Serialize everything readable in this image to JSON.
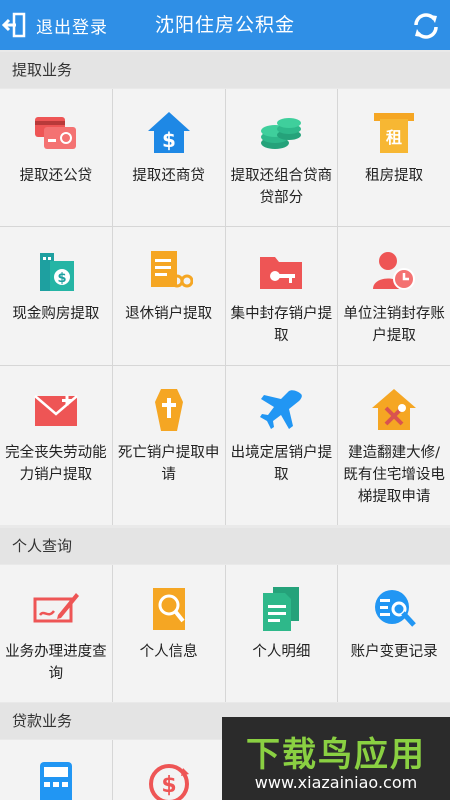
{
  "header": {
    "logout_label": "退出登录",
    "title": "沈阳住房公积金",
    "logout_icon": "logout-icon",
    "refresh_icon": "refresh-icon"
  },
  "sections": [
    {
      "title": "提取业务",
      "items": [
        {
          "label": "提取还公贷",
          "icon": "cards-icon"
        },
        {
          "label": "提取还商贷",
          "icon": "house-dollar-icon"
        },
        {
          "label": "提取还组合贷商贷部分",
          "icon": "coins-stack-icon"
        },
        {
          "label": "租房提取",
          "icon": "rent-icon"
        },
        {
          "label": "现金购房提取",
          "icon": "building-dollar-icon"
        },
        {
          "label": "退休销户提取",
          "icon": "retire-document-icon"
        },
        {
          "label": "集中封存销户提取",
          "icon": "folder-key-icon"
        },
        {
          "label": "单位注销封存账户提取",
          "icon": "user-clock-icon"
        },
        {
          "label": "完全丧失劳动能力销户提取",
          "icon": "medical-envelope-icon"
        },
        {
          "label": "死亡销户提取申请",
          "icon": "coffin-icon"
        },
        {
          "label": "出境定居销户提取",
          "icon": "airplane-icon"
        },
        {
          "label": "建造翻建大修/既有住宅增设电梯提取申请",
          "icon": "house-tools-icon"
        }
      ]
    },
    {
      "title": "个人查询",
      "items": [
        {
          "label": "业务办理进度查询",
          "icon": "check-pen-icon"
        },
        {
          "label": "个人信息",
          "icon": "profile-search-icon"
        },
        {
          "label": "个人明细",
          "icon": "documents-icon"
        },
        {
          "label": "账户变更记录",
          "icon": "search-record-icon"
        }
      ]
    },
    {
      "title": "贷款业务",
      "items": [
        {
          "label": "",
          "icon": "calculator-icon"
        },
        {
          "label": "",
          "icon": "dollar-refresh-icon"
        }
      ]
    }
  ],
  "watermark": {
    "main": "下载鸟应用",
    "url": "www.xiazainiao.com"
  },
  "colors": {
    "header_bg": "#2f8fe6",
    "red": "#ee5555",
    "blue": "#2196f3",
    "green": "#2eb88a",
    "orange": "#f5a623",
    "teal": "#1ea0a0"
  }
}
